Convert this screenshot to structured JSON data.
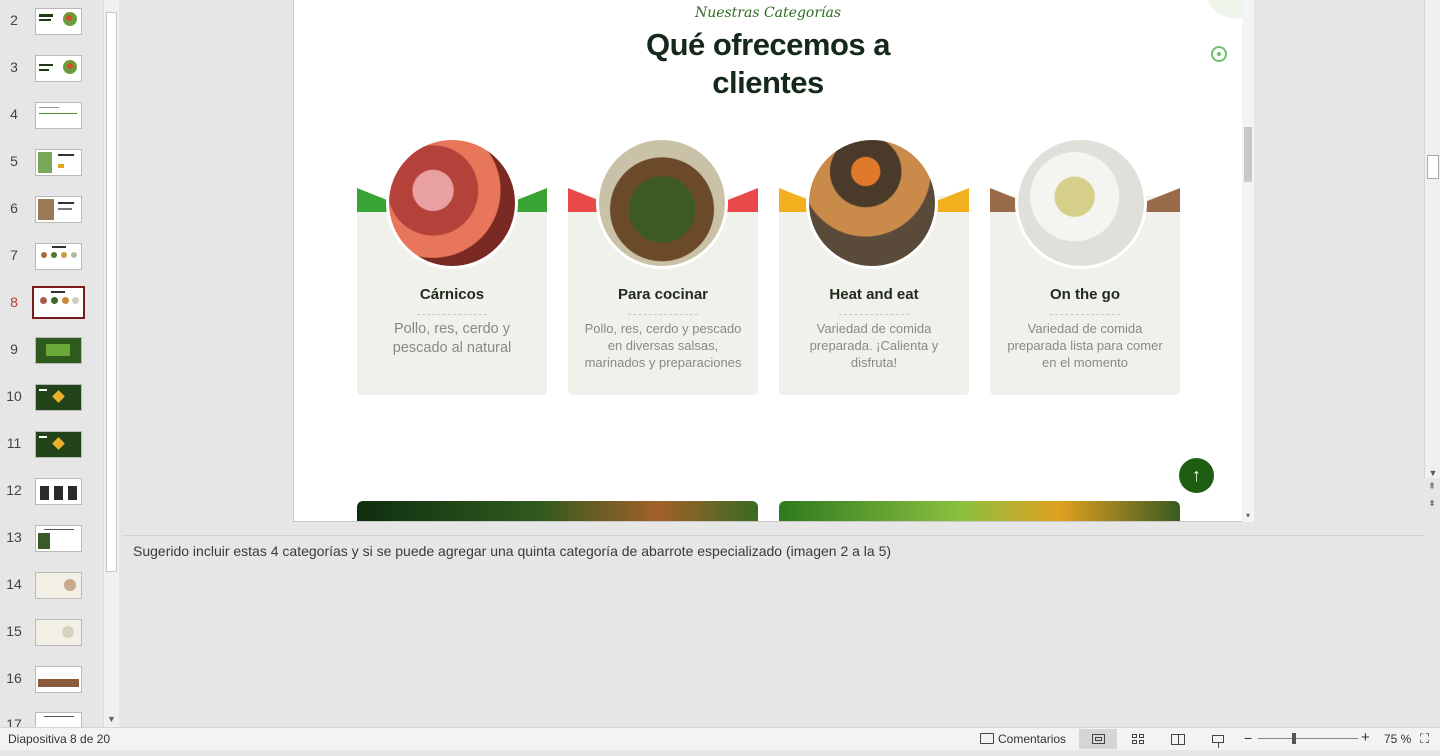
{
  "thumbnails": [
    {
      "num": "2"
    },
    {
      "num": "3"
    },
    {
      "num": "4"
    },
    {
      "num": "5"
    },
    {
      "num": "6"
    },
    {
      "num": "7"
    },
    {
      "num": "8",
      "active": true
    },
    {
      "num": "9"
    },
    {
      "num": "10"
    },
    {
      "num": "11"
    },
    {
      "num": "12"
    },
    {
      "num": "13"
    },
    {
      "num": "14"
    },
    {
      "num": "15"
    },
    {
      "num": "16"
    },
    {
      "num": "17"
    }
  ],
  "slide": {
    "subtitle": "Nuestras Categorías",
    "title_line1": "Qué ofrecemos a",
    "title_line2": "clientes",
    "cards": [
      {
        "title": "Cárnicos",
        "desc": "Pollo, res, cerdo y pescado al natural",
        "band_color": "#3aa335"
      },
      {
        "title": "Para cocinar",
        "desc": "Pollo, res, cerdo y pescado en diversas salsas, marinados y preparaciones",
        "band_color": "#e84a4a"
      },
      {
        "title": "Heat and eat",
        "desc": "Variedad de comida preparada. ¡Calienta y disfruta!",
        "band_color": "#f2b01e"
      },
      {
        "title": "On the go",
        "desc": "Variedad de comida preparada lista para comer en el momento",
        "band_color": "#9a6b4a"
      }
    ],
    "scroll_top_glyph": "↑"
  },
  "notes": {
    "text": "Sugerido incluir estas 4 categorías y si se puede agregar una quinta categoría de abarrote especializado (imagen 2 a la 5)"
  },
  "status": {
    "slide_count": "Diapositiva 8 de 20",
    "comments_label": "Comentarios",
    "zoom": "75 %",
    "zoom_minus": "−",
    "zoom_plus": "+"
  },
  "colors": {
    "accent_selected": "#7a1a1a",
    "brand_green": "#1e5d12"
  }
}
